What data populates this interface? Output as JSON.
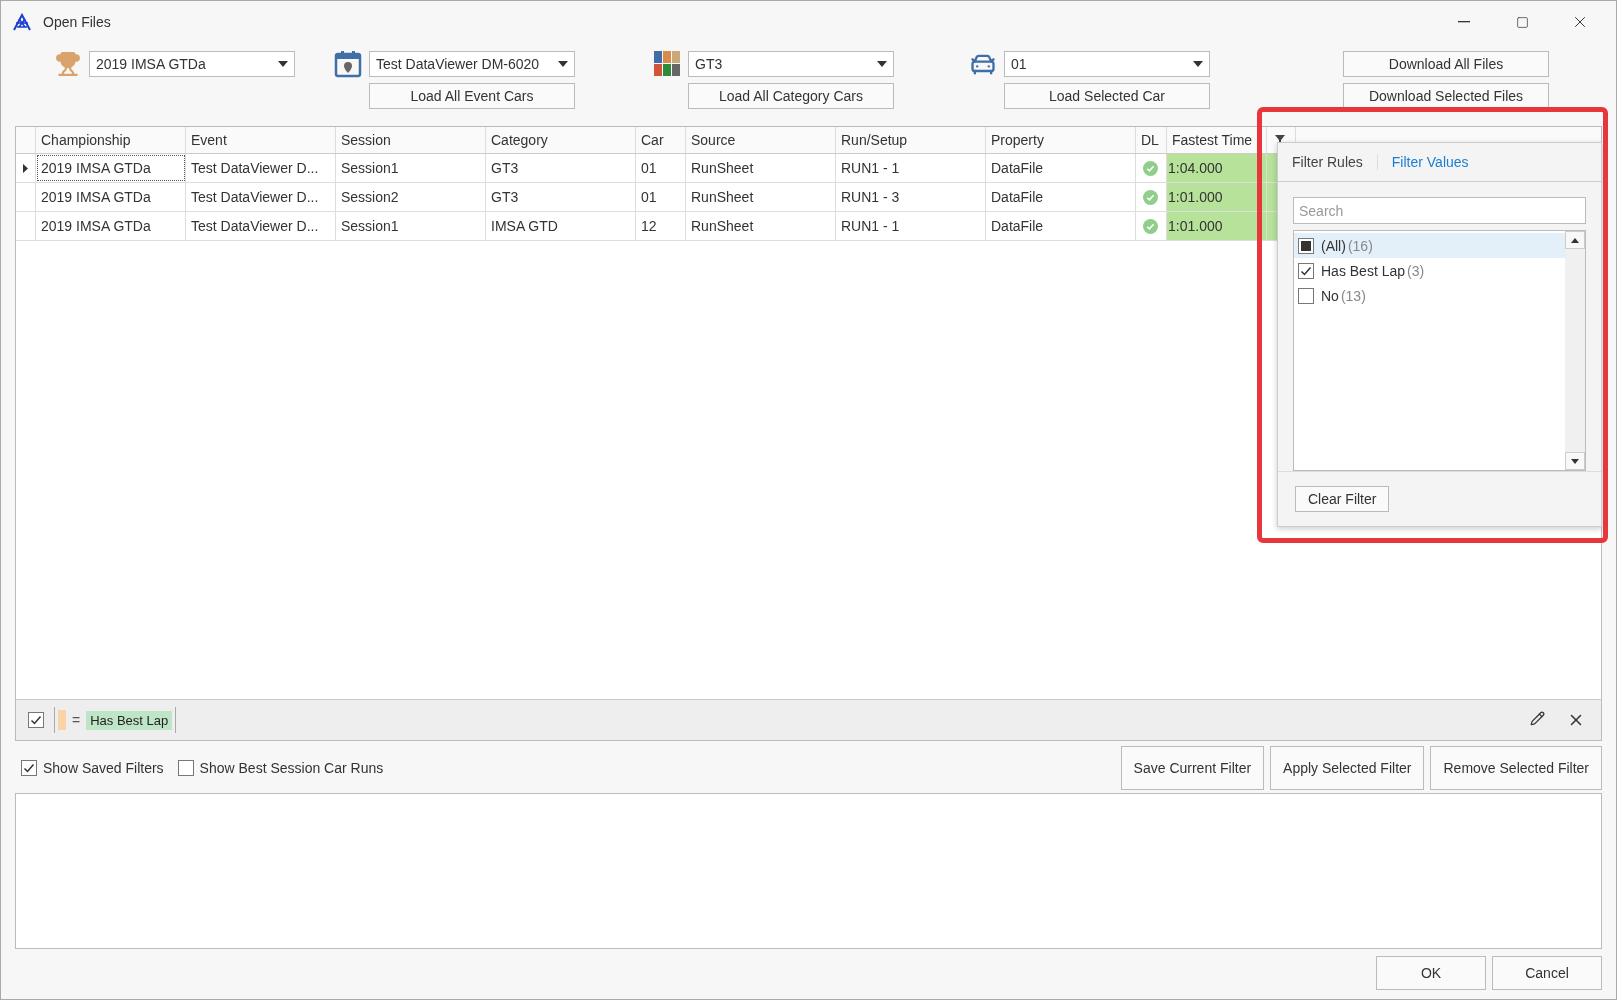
{
  "window": {
    "title": "Open Files"
  },
  "selectors": [
    {
      "kind": "championship",
      "value": "2019 IMSA GTDa"
    },
    {
      "kind": "event",
      "value": "Test DataViewer DM-6020",
      "button": "Load All Event Cars"
    },
    {
      "kind": "category",
      "value": "GT3",
      "button": "Load All Category Cars"
    },
    {
      "kind": "car",
      "value": "01",
      "button": "Load Selected Car"
    }
  ],
  "download_buttons": [
    "Download All Files",
    "Download Selected Files"
  ],
  "table": {
    "columns": [
      "Championship",
      "Event",
      "Session",
      "Category",
      "Car",
      "Source",
      "Run/Setup",
      "Property",
      "DL",
      "Fastest Time"
    ],
    "rows": [
      {
        "current": true,
        "downloaded": true,
        "best": true,
        "cells": [
          "2019 IMSA GTDa",
          "Test DataViewer D...",
          "Session1",
          "GT3",
          "01",
          "RunSheet",
          "RUN1 - 1",
          "DataFile",
          "1:04.000"
        ]
      },
      {
        "current": false,
        "downloaded": true,
        "best": true,
        "cells": [
          "2019 IMSA GTDa",
          "Test DataViewer D...",
          "Session2",
          "GT3",
          "01",
          "RunSheet",
          "RUN1 - 3",
          "DataFile",
          "1:01.000"
        ]
      },
      {
        "current": false,
        "downloaded": true,
        "best": true,
        "cells": [
          "2019 IMSA GTDa",
          "Test DataViewer D...",
          "Session1",
          "IMSA GTD",
          "12",
          "RunSheet",
          "RUN1 - 1",
          "DataFile",
          "1:01.000"
        ]
      }
    ]
  },
  "filter_popup": {
    "tabs": [
      {
        "label": "Filter Rules",
        "selected": false
      },
      {
        "label": "Filter Values",
        "selected": true
      }
    ],
    "search": {
      "placeholder": "Search"
    },
    "items": [
      {
        "label": "(All)",
        "count": "(16)",
        "checked": false,
        "indeterminate": true,
        "selected": true
      },
      {
        "label": "Has Best Lap",
        "count": "(3)",
        "checked": true,
        "indeterminate": false,
        "selected": false
      },
      {
        "label": "No",
        "count": "(13)",
        "checked": false,
        "indeterminate": false,
        "selected": false
      }
    ],
    "button": "Clear Filter"
  },
  "filter_bar": {
    "enabled": true,
    "operator": "=",
    "value": "Has Best Lap"
  },
  "options": [
    {
      "label": "Show Saved Filters",
      "checked": true
    },
    {
      "label": "Show Best Session Car Runs",
      "checked": false
    }
  ],
  "filter_buttons": [
    "Save Current Filter",
    "Apply Selected Filter",
    "Remove Selected Filter"
  ],
  "dialog_buttons": [
    "OK",
    "Cancel"
  ]
}
